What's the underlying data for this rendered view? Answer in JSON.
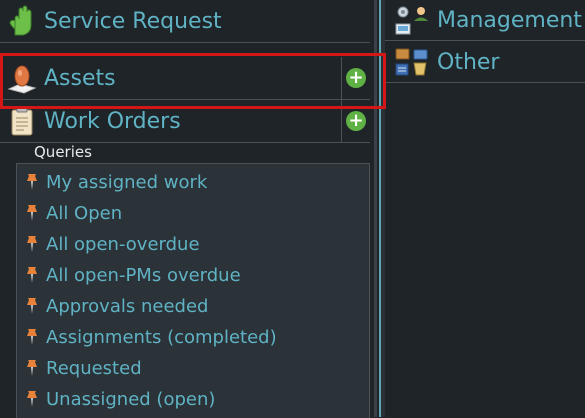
{
  "left": {
    "service_request": {
      "title": "Service Request",
      "icon": "hand-icon"
    },
    "assets": {
      "title": "Assets",
      "icon": "assets-icon",
      "add": "+"
    },
    "work_orders": {
      "title": "Work Orders",
      "icon": "clipboard-icon",
      "add": "+"
    },
    "queries": {
      "label": "Queries",
      "items": [
        "My assigned work",
        "All Open",
        "All open-overdue",
        "All open-PMs overdue",
        "Approvals needed",
        "Assignments (completed)",
        "Requested",
        "Unassigned (open)"
      ]
    }
  },
  "right": {
    "management": {
      "title": "Management",
      "icon": "management-icon"
    },
    "other": {
      "title": "Other",
      "icon": "other-icon"
    }
  },
  "colors": {
    "accent": "#5fb3c4",
    "background": "#1f2428",
    "queries_background": "#2b3238",
    "add_button": "#5fb145",
    "highlight": "#d31616"
  }
}
